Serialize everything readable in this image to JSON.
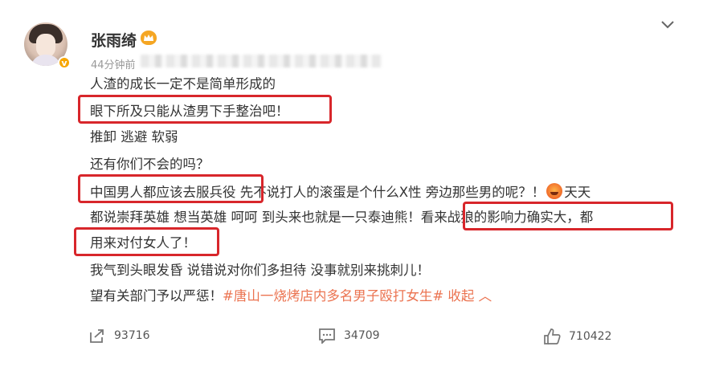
{
  "post": {
    "username": "张雨绮",
    "timestamp": "44分钟前",
    "vip_badge": "v",
    "lines": [
      {
        "segments": [
          {
            "text": "人渣的成长一定不是简单形成的"
          }
        ]
      },
      {
        "segments": [
          {
            "text": "眼下所及只能从渣男下手整治吧！"
          }
        ]
      },
      {
        "segments": [
          {
            "text": "推卸 逃避 软弱"
          }
        ]
      },
      {
        "segments": [
          {
            "text": "还有你们不会的吗？"
          }
        ]
      },
      {
        "segments": [
          {
            "text": "中国男人都应该去服兵役 先不说打人的滚蛋是个什么X性 旁边那些男的呢？！"
          },
          {
            "emoji": "angry-face"
          },
          {
            "text": "天天"
          }
        ]
      },
      {
        "segments": [
          {
            "text": "都说崇拜英雄 想当英雄 呵呵 到头来也就是一只泰迪熊！看来战狼的影响力确实大，都"
          }
        ]
      },
      {
        "segments": [
          {
            "text": "用来对付女人了！"
          }
        ]
      },
      {
        "segments": [
          {
            "text": "我气到头眼发昏 说错说对你们多担待 没事就别来挑刺儿！"
          }
        ]
      },
      {
        "segments": [
          {
            "text": "望有关部门予以严惩！"
          },
          {
            "text": "#唐山一烧烤店内多名男子殴打女生#",
            "hashtag": true
          },
          {
            "text": " 收起",
            "collapse": true
          }
        ]
      }
    ]
  },
  "actions": {
    "repost_count": "93716",
    "comment_count": "34709",
    "like_count": "710422"
  },
  "icons": {
    "menu": "chevron-down-icon",
    "repost": "repost-icon",
    "comment": "comment-icon",
    "like": "thumbs-up-icon",
    "collapse": "chevron-up-icon"
  },
  "colors": {
    "highlight_box": "#d8262b",
    "hashtag": "#eb7350",
    "text": "#333333",
    "meta": "#999999"
  }
}
